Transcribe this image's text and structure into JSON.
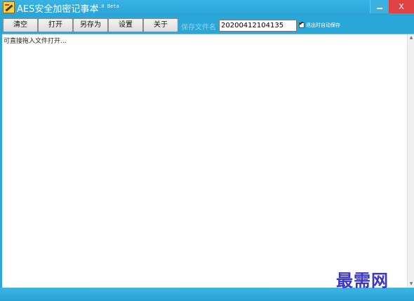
{
  "window": {
    "title": "AES安全加密记事本",
    "version": "1.0 Beta",
    "close_label": "X"
  },
  "toolbar": {
    "buttons": [
      {
        "label": "清空"
      },
      {
        "label": "打开"
      },
      {
        "label": "另存为"
      },
      {
        "label": "设置"
      },
      {
        "label": "关于"
      }
    ],
    "save_filename_label": "保存文件名",
    "filename_value": "20200412104135",
    "autosave_label": "退出时自动保存",
    "autosave_checked": true
  },
  "editor": {
    "placeholder_text": "可直接拖入文件打开..."
  },
  "watermark": {
    "text": "最需网"
  },
  "colors": {
    "chrome": "#2aa7d9",
    "close": "#e04343",
    "watermark": "#3c35c9"
  }
}
